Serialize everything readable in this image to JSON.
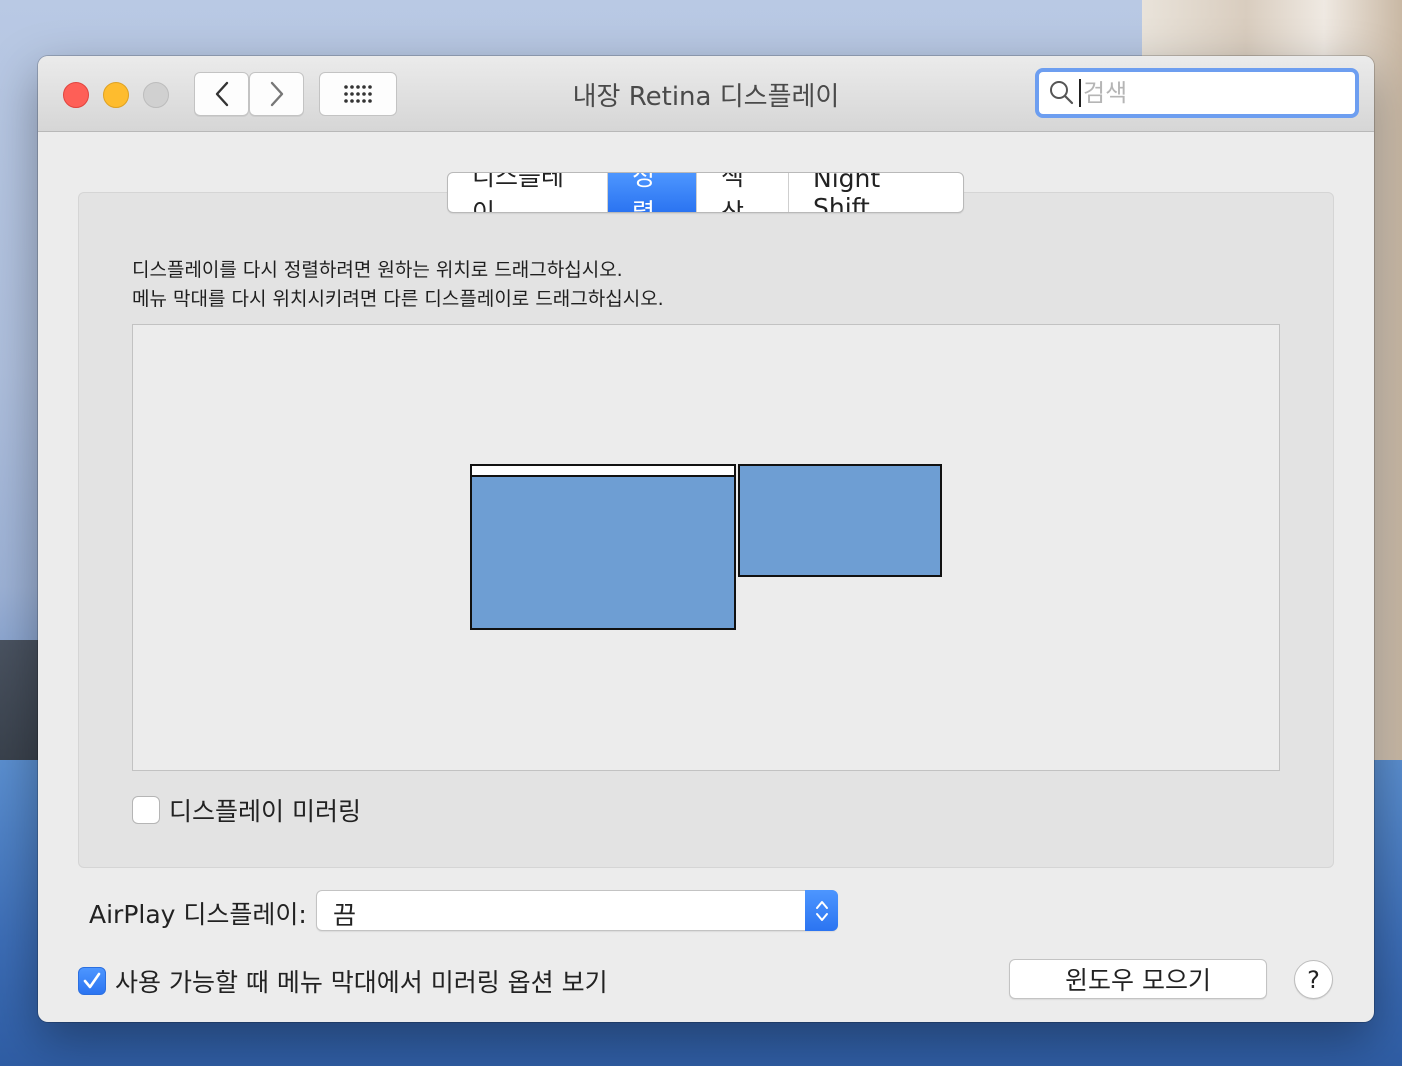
{
  "window": {
    "title": "내장 Retina 디스플레이"
  },
  "search": {
    "placeholder": "검색",
    "value": ""
  },
  "tabs": [
    {
      "label": "디스플레이",
      "active": false
    },
    {
      "label": "정렬",
      "active": true
    },
    {
      "label": "색상",
      "active": false
    },
    {
      "label": "Night Shift",
      "active": false
    }
  ],
  "arrangement": {
    "instruction_line1": "디스플레이를 다시 정렬하려면 원하는 위치로 드래그하십시오.",
    "instruction_line2": "메뉴 막대를 다시 위치시키려면 다른 디스플레이로 드래그하십시오.",
    "display_color": "#6e9ed3"
  },
  "mirroring": {
    "label": "디스플레이 미러링",
    "checked": false
  },
  "airplay": {
    "label": "AirPlay 디스플레이:",
    "selected": "끔"
  },
  "menu_option": {
    "label": "사용 가능할 때 메뉴 막대에서 미러링 옵션 보기",
    "checked": true
  },
  "buttons": {
    "gather_windows": "윈도우 모으기",
    "help": "?"
  },
  "colors": {
    "accent": "#2b74f1",
    "close": "#fe5f57",
    "minimize": "#febc2e",
    "disabled": "#d0d0d0"
  }
}
